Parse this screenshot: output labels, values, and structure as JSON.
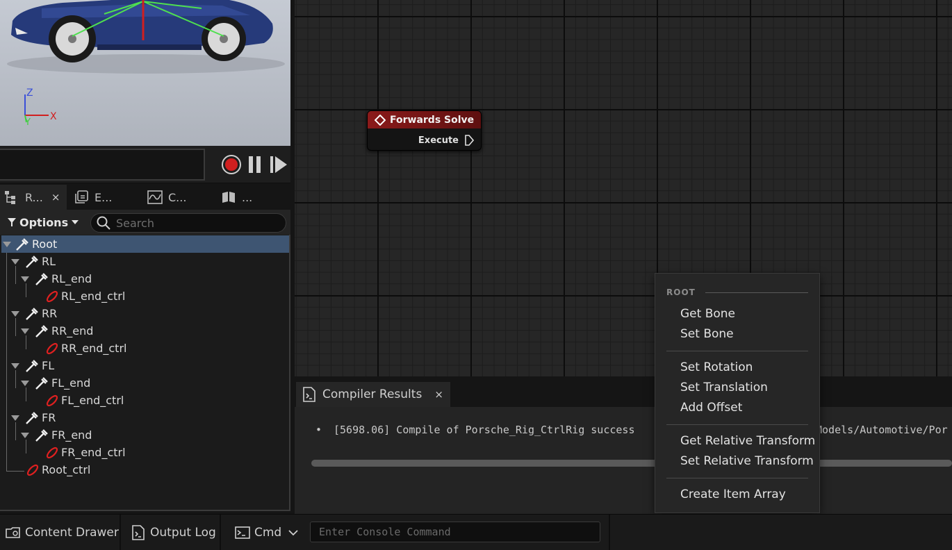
{
  "viewport": {
    "axis": {
      "z": "Z",
      "y": "Y",
      "x": "X"
    }
  },
  "transport": {
    "record_color": "#d11f1f"
  },
  "tabs": [
    {
      "label": "R...",
      "icon": "rig-hierarchy-icon",
      "active": true,
      "close": "×"
    },
    {
      "label": "E...",
      "icon": "layers-icon"
    },
    {
      "label": "C...",
      "icon": "curve-icon"
    },
    {
      "label": "...",
      "icon": "book-icon"
    }
  ],
  "toolbar": {
    "options_label": "Options",
    "search_placeholder": "Search"
  },
  "tree": {
    "items": [
      {
        "label": "Root",
        "type": "bone",
        "depth": 0,
        "selected": true
      },
      {
        "label": "RL",
        "type": "bone",
        "depth": 1
      },
      {
        "label": "RL_end",
        "type": "bone",
        "depth": 2
      },
      {
        "label": "RL_end_ctrl",
        "type": "control",
        "depth": 3
      },
      {
        "label": "RR",
        "type": "bone",
        "depth": 1
      },
      {
        "label": "RR_end",
        "type": "bone",
        "depth": 2
      },
      {
        "label": "RR_end_ctrl",
        "type": "control",
        "depth": 3
      },
      {
        "label": "FL",
        "type": "bone",
        "depth": 1
      },
      {
        "label": "FL_end",
        "type": "bone",
        "depth": 2
      },
      {
        "label": "FL_end_ctrl",
        "type": "control",
        "depth": 3
      },
      {
        "label": "FR",
        "type": "bone",
        "depth": 1
      },
      {
        "label": "FR_end",
        "type": "bone",
        "depth": 2
      },
      {
        "label": "FR_end_ctrl",
        "type": "control",
        "depth": 3
      },
      {
        "label": "Root_ctrl",
        "type": "control",
        "depth": 2
      }
    ]
  },
  "graph": {
    "node": {
      "title": "Forwards Solve",
      "pin": "Execute",
      "header_color": "#8a1a1a"
    }
  },
  "compiler": {
    "tab_label": "Compiler Results",
    "close": "×",
    "bullet": "•",
    "message_start": "[5698.06] Compile of Porsche_Rig_CtrlRig success",
    "message_end": "Models/Automotive/Por"
  },
  "context_menu": {
    "header": "ROOT",
    "groups": [
      [
        "Get Bone",
        "Set Bone"
      ],
      [
        "Set Rotation",
        "Set Translation",
        "Add Offset"
      ],
      [
        "Get Relative Transform",
        "Set Relative Transform"
      ],
      [
        "Create Item Array"
      ]
    ]
  },
  "bottom_bar": {
    "content_drawer": "Content Drawer",
    "output_log": "Output Log",
    "cmd": "Cmd",
    "console_placeholder": "Enter Console Command"
  }
}
